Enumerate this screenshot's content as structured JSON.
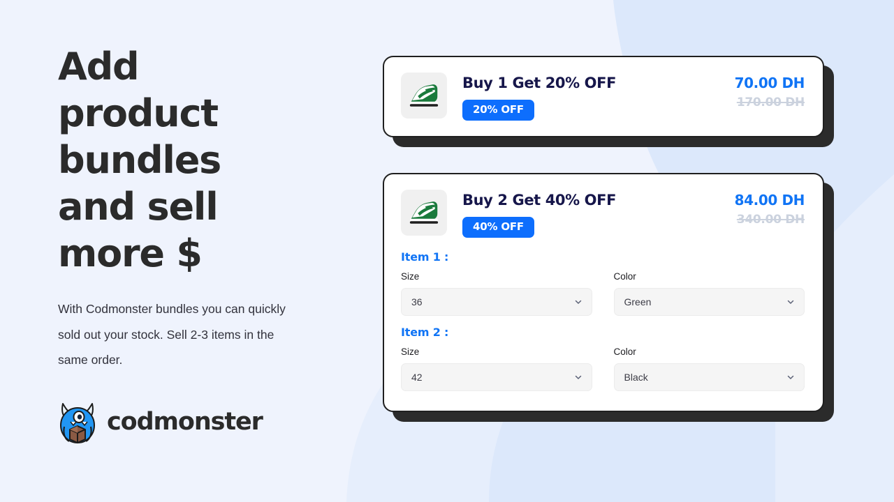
{
  "theme": {
    "background": "#eff3fd",
    "accent_blue": "#0d6efd",
    "price_blue": "#1074f5",
    "title_navy": "#16164a",
    "ink": "#2b2b2b",
    "arc_blue": "#dce8fb"
  },
  "marketing": {
    "headline": "Add product bundles and sell more $",
    "body": "With Codmonster bundles you can quickly sold out your stock. Sell 2-3 items in the same order.",
    "logo_text": "codmonster",
    "logo_icon": "codmonster-monster-icon"
  },
  "bundles": [
    {
      "thumbnail_icon": "green-sneaker-icon",
      "title": "Buy 1 Get 20% OFF",
      "badge": "20% OFF",
      "price_new": "70.00 DH",
      "price_old": "170.00 DH",
      "items": []
    },
    {
      "thumbnail_icon": "green-sneaker-icon",
      "title": "Buy 2 Get 40% OFF",
      "badge": "40% OFF",
      "price_new": "84.00 DH",
      "price_old": "340.00 DH",
      "items": [
        {
          "heading": "Item 1 :",
          "size_label": "Size",
          "size_value": "36",
          "color_label": "Color",
          "color_value": "Green"
        },
        {
          "heading": "Item 2 :",
          "size_label": "Size",
          "size_value": "42",
          "color_label": "Color",
          "color_value": "Black"
        }
      ]
    }
  ]
}
